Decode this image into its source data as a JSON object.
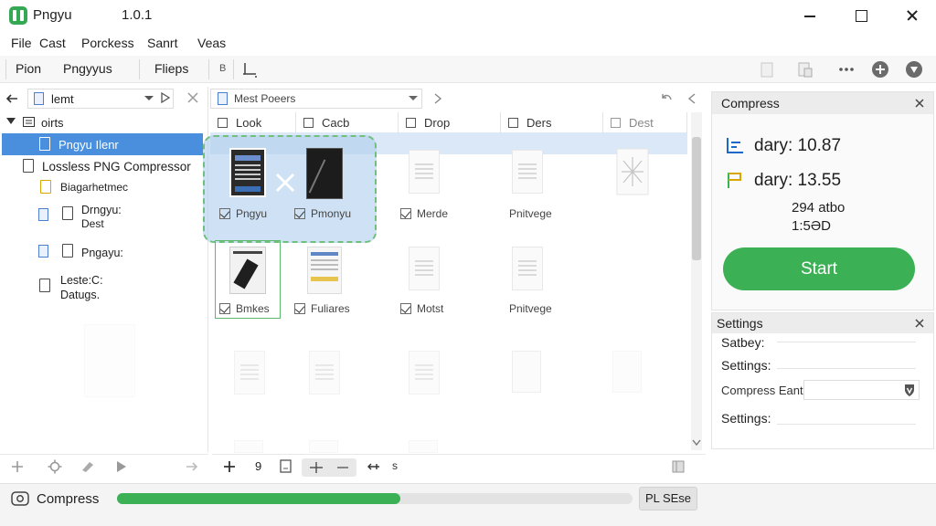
{
  "window": {
    "title": "Pngyu",
    "version": "1.0.1"
  },
  "menu": [
    "File",
    "Cast",
    "Porckess",
    "Sanrt",
    "Veas"
  ],
  "toolbar": {
    "item1": "Pion",
    "item2": "Pngyyus",
    "item3": "Flieps",
    "item4": "B"
  },
  "left_panel": {
    "path_label": "lemt",
    "tree": [
      {
        "label": "oirts"
      },
      {
        "label": "Pngyu Ilenr",
        "selected": true
      },
      {
        "label": "Lossless PNG Compressor"
      },
      {
        "label": "Biagarhetmec"
      },
      {
        "label_line1": "Drngyu:",
        "label_line2": "Dest"
      },
      {
        "label": "Pngayu:"
      },
      {
        "label_line1": "Leste:C:",
        "label_line2": "Datugs."
      }
    ]
  },
  "grid": {
    "path_label": "Mest Poeers",
    "columns": [
      "Look",
      "Cacb",
      "Drop",
      "Ders",
      "Dest"
    ],
    "row1": [
      {
        "label": "Pngyu",
        "checked": true
      },
      {
        "label": "Pmonyu",
        "checked": true
      },
      {
        "label": "Merde",
        "checked": true
      },
      {
        "label": "Pnitvege",
        "checked": false
      }
    ],
    "row2": [
      {
        "label": "Bmkes",
        "checked": true
      },
      {
        "label": "Fuliares",
        "checked": true
      },
      {
        "label": "Motst",
        "checked": true
      },
      {
        "label": "Pnitvege",
        "checked": false
      }
    ]
  },
  "compress_panel": {
    "title": "Compress",
    "stat1": "dary: 10.87",
    "stat2": "dary: 13.55",
    "stat3": "294 atbo",
    "stat4": "1:5ƏD",
    "start_label": "Start"
  },
  "settings_panel": {
    "title": "Settings",
    "rows": [
      "Satbey:",
      "Settings:",
      "Settings:"
    ],
    "compress_label": "Compress Eant"
  },
  "bottom_bar": {
    "page": "9"
  },
  "status": {
    "label": "Compress",
    "progress": 0.55,
    "button": "PL SEse"
  },
  "colors": {
    "accent": "#3bb055",
    "selection": "#4a8fdd",
    "drop_overlay": "#cfe0f3"
  }
}
